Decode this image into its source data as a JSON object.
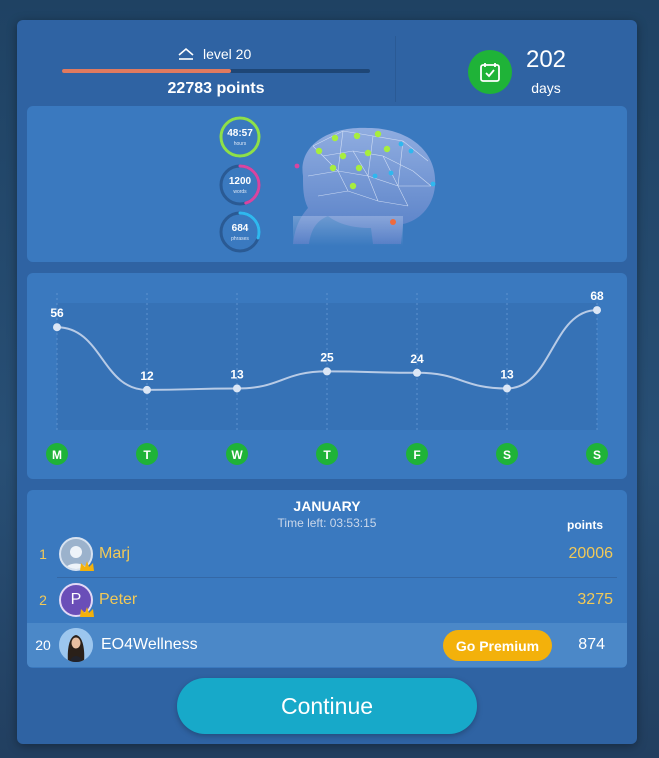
{
  "header": {
    "level_label": "level 20",
    "level_progress": 0.55,
    "points_total": "22783 points",
    "days_value": "202",
    "days_label": "days"
  },
  "stats": {
    "rings": [
      {
        "value": "48:57",
        "label": "hours",
        "color": "#8ee04a",
        "fraction": 1.0
      },
      {
        "value": "1200",
        "label": "words",
        "color": "#d845a0",
        "fraction": 0.45
      },
      {
        "value": "684",
        "label": "phrases",
        "color": "#2fb8ef",
        "fraction": 0.3
      }
    ]
  },
  "chart_data": {
    "type": "line",
    "categories": [
      "M",
      "T",
      "W",
      "T",
      "F",
      "S",
      "S"
    ],
    "values": [
      56,
      12,
      13,
      25,
      24,
      13,
      68
    ],
    "ylim": [
      0,
      80
    ],
    "grid": "vertical dotted",
    "colors": {
      "line": "#b8cbe6",
      "day_badge": "#1fb338"
    }
  },
  "leaderboard": {
    "month": "JANUARY",
    "time_left": "Time left: 03:53:15",
    "points_header": "points",
    "rows": [
      {
        "rank": "1",
        "name": "Marj",
        "points": "20006",
        "avatar": "user-silhouette",
        "crown": true,
        "highlight": false
      },
      {
        "rank": "2",
        "name": "Peter",
        "points": "3275",
        "avatar": "P",
        "crown": true,
        "highlight": false
      },
      {
        "rank": "20",
        "name": "EO4Wellness",
        "points": "874",
        "avatar": "photo",
        "crown": false,
        "highlight": true
      }
    ],
    "premium_label": "Go Premium"
  },
  "footer": {
    "continue_label": "Continue"
  },
  "colors": {
    "card": "#2f63a3",
    "panel": "#3a79bf",
    "accent_green": "#1fb338",
    "gold": "#f2c957",
    "premium": "#f3b10b",
    "continue": "#17a9c9",
    "progress": "#e07a5f"
  }
}
